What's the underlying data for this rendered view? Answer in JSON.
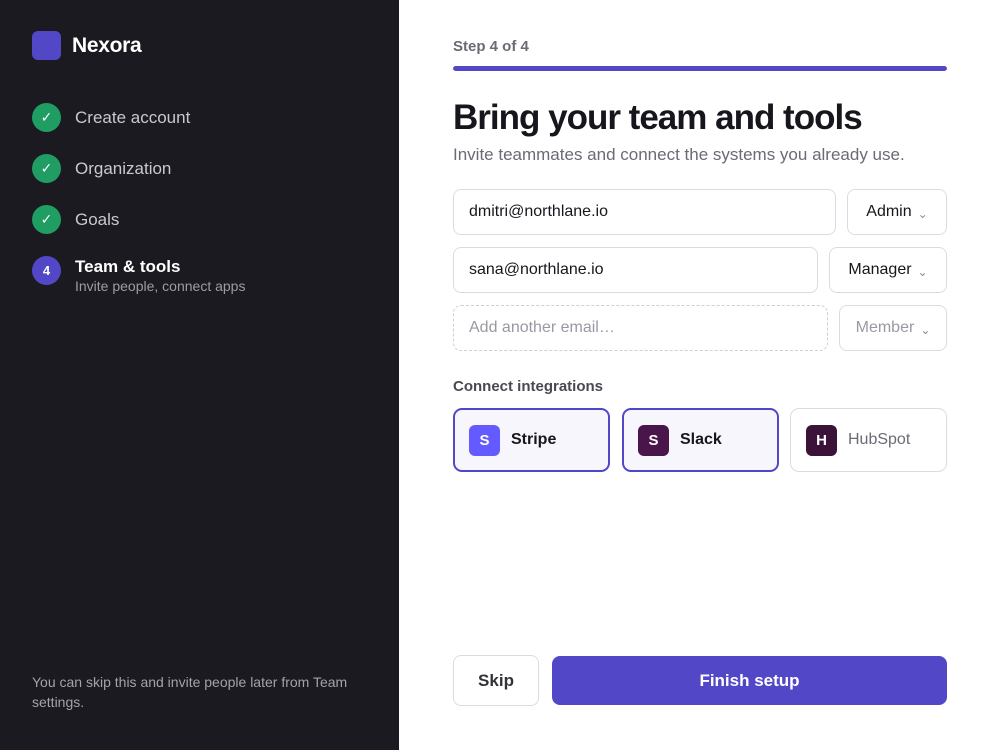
{
  "app": {
    "name": "Nexora",
    "brand_color": "#5248c7"
  },
  "sidebar": {
    "steps": [
      {
        "label": "Create account",
        "status": "done",
        "marker": "✓"
      },
      {
        "label": "Organization",
        "status": "done",
        "marker": "✓"
      },
      {
        "label": "Goals",
        "status": "done",
        "marker": "✓"
      },
      {
        "label": "Team & tools",
        "status": "current",
        "marker": "4",
        "sublabel": "Invite people, connect apps"
      }
    ],
    "note": "You can skip this and invite people later from Team settings."
  },
  "main": {
    "step_counter": "Step 4 of 4",
    "progress_percent": 100,
    "title": "Bring your team and tools",
    "subtitle": "Invite teammates and connect the systems you already use.",
    "invites": [
      {
        "email": "dmitri@northlane.io",
        "role": "Admin"
      },
      {
        "email": "sana@northlane.io",
        "role": "Manager"
      },
      {
        "email": "",
        "placeholder": "Add another email…",
        "role": "Member"
      }
    ],
    "role_chevron": "⌄",
    "integrations_label": "Connect integrations",
    "integrations": [
      {
        "name": "Stripe",
        "initial": "S",
        "selected": true,
        "icon_color": "#635bff"
      },
      {
        "name": "Slack",
        "initial": "S",
        "selected": true,
        "icon_color": "#4a154b"
      },
      {
        "name": "HubSpot",
        "initial": "H",
        "selected": false,
        "icon_color": "#3b1238"
      }
    ],
    "skip_label": "Skip",
    "finish_label": "Finish setup"
  }
}
